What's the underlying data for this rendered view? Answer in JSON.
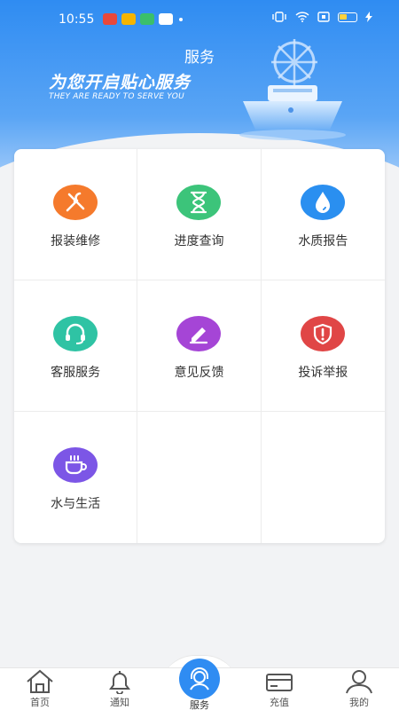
{
  "status_bar": {
    "time": "10:55",
    "battery_color": "#ffd23c"
  },
  "header": {
    "title": "服务",
    "slogan_cn": "为您开启贴心服务",
    "slogan_en": "THEY ARE READY TO SERVE YOU"
  },
  "services": [
    {
      "label": "报装维修",
      "icon": "wrench-screwdriver-icon",
      "color": "#f57a2c"
    },
    {
      "label": "进度查询",
      "icon": "hourglass-icon",
      "color": "#3cc47a"
    },
    {
      "label": "水质报告",
      "icon": "water-drop-icon",
      "color": "#2a8ff0"
    },
    {
      "label": "客服服务",
      "icon": "headset-icon",
      "color": "#2fc3a4"
    },
    {
      "label": "意见反馈",
      "icon": "pencil-icon",
      "color": "#a545d6"
    },
    {
      "label": "投诉举报",
      "icon": "shield-alert-icon",
      "color": "#e04646"
    },
    {
      "label": "水与生活",
      "icon": "coffee-cup-icon",
      "color": "#7c56e6"
    },
    {
      "label": "",
      "icon": "",
      "color": ""
    },
    {
      "label": "",
      "icon": "",
      "color": ""
    }
  ],
  "tabbar": {
    "home_label": "首页",
    "notice_label": "通知",
    "service_label": "服务",
    "recharge_label": "充值",
    "mine_label": "我的",
    "active": "服务",
    "accent": "#2f8cf2"
  }
}
